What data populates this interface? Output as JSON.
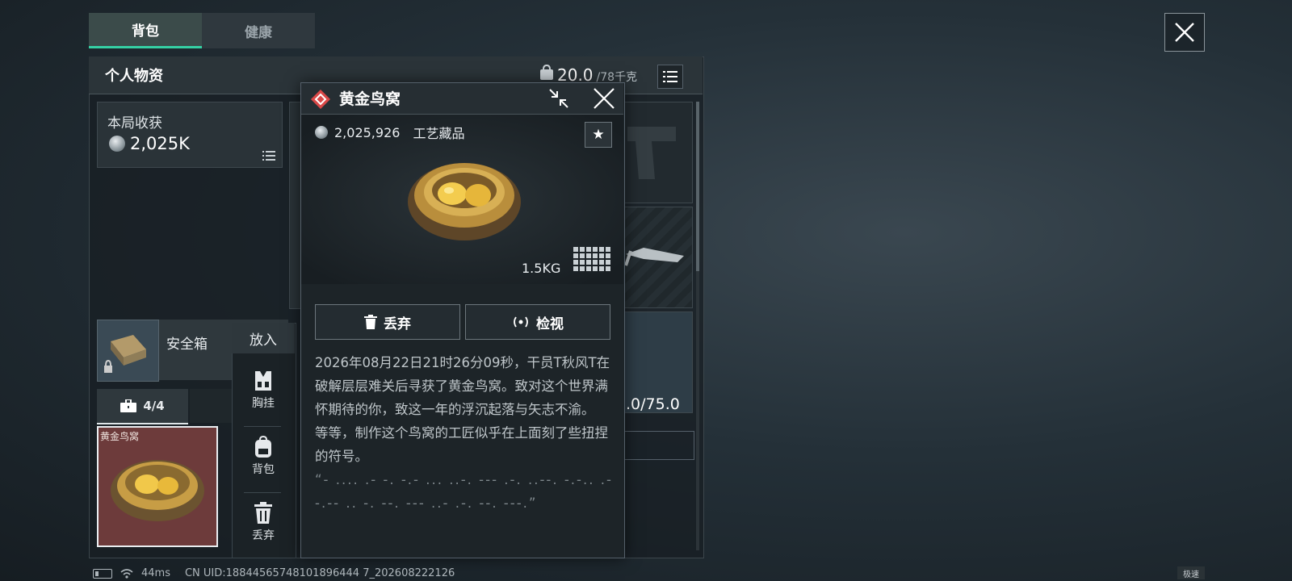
{
  "tabs": {
    "active": "背包",
    "inactive": "健康"
  },
  "panel": {
    "title": "个人物资",
    "weight_current": "20.0",
    "weight_max": "/78千克"
  },
  "harvest": {
    "label": "本局收获",
    "value": "2,025K"
  },
  "safebox": {
    "label": "安全箱",
    "tab_count": "4/4"
  },
  "item_card": {
    "name": "黄金鸟窝"
  },
  "action_menu": {
    "header": "放入",
    "items": [
      {
        "label": "胸挂",
        "icon": "vest-icon"
      },
      {
        "label": "背包",
        "icon": "backpack-icon"
      },
      {
        "label": "丢弃",
        "icon": "trash-icon"
      }
    ]
  },
  "detail": {
    "title": "黄金鸟窝",
    "price": "2,025,926",
    "category": "工艺藏品",
    "weight": "1.5KG",
    "discard_label": "丢弃",
    "inspect_label": "检视",
    "description": [
      "2026年08月22日21时26分09秒，干员T秋风T在破解层层难关后寻获了黄金鸟窝。致对这个世界满怀期待的你，致这一年的浮沉起落与矢志不渝。",
      "等等，制作这个鸟窝的工匠似乎在上面刻了些扭捏的符号。",
      "“- .... .- -. -.- ... ..-. --- .-. ..--. -.-.. .- -.-- .. -. --. --- ..- .-. --. ---.”"
    ]
  },
  "capacity": ".0/75.0",
  "status_bar": {
    "ping": "44ms",
    "uid": "CN UID:18844565748101896444 7_202608222126"
  },
  "speed_badge": "极速",
  "colors": {
    "accent": "#35d1a4",
    "rarity": "#d94848",
    "item_bg": "#6d3b3b"
  }
}
